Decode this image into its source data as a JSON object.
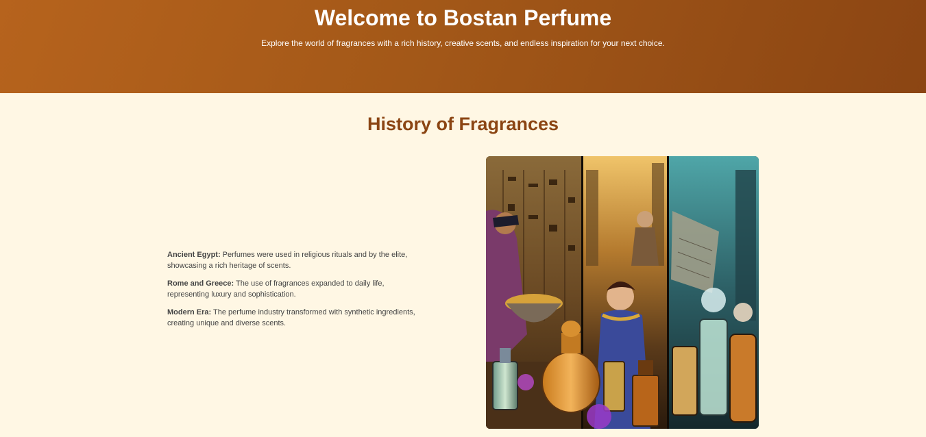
{
  "hero": {
    "title": "Welcome to Bostan Perfume",
    "subtitle": "Explore the world of fragrances with a rich history, creative scents, and endless inspiration for your next choice."
  },
  "history": {
    "title": "History of Fragrances",
    "items": [
      {
        "label": "Ancient Egypt:",
        "text": " Perfumes were used in religious rituals and by the elite, showcasing a rich heritage of scents."
      },
      {
        "label": "Rome and Greece:",
        "text": " The use of fragrances expanded to daily life, representing luxury and sophistication."
      },
      {
        "label": "Modern Era:",
        "text": " The perfume industry transformed with synthetic ingredients, creating unique and diverse scents."
      }
    ],
    "image_icon": "perfume-history-illustration"
  }
}
